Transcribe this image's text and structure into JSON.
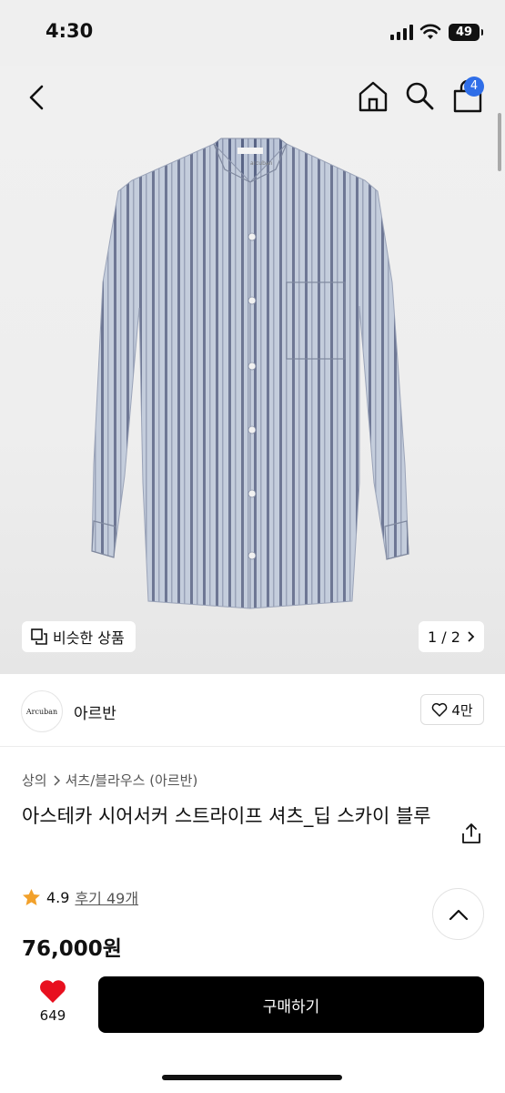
{
  "status_bar": {
    "time": "4:30",
    "battery": "49"
  },
  "header": {
    "back_icon": "chevron-left-icon",
    "home_icon": "home-icon",
    "search_icon": "search-icon",
    "cart_icon": "shopping-bag-icon",
    "cart_count": "4",
    "badge_color": "#2f6ee8"
  },
  "gallery": {
    "product_label": "arcuban",
    "similar_label": "비슷한 상품",
    "pager": "1 / 2"
  },
  "brand": {
    "logo_text": "Arcuban",
    "name": "아르반",
    "like_count": "4만"
  },
  "product": {
    "breadcrumb": [
      "상의",
      "셔츠/블라우스 (아르반)"
    ],
    "title": "아스테카 시어서커 스트라이프 셔츠_딥 스카이 블루",
    "rating": "4.9",
    "reviews": "후기 49개",
    "price": "76,000원"
  },
  "bottom_bar": {
    "wish_count": "649",
    "buy_label": "구매하기",
    "heart_color": "#e8101f"
  }
}
